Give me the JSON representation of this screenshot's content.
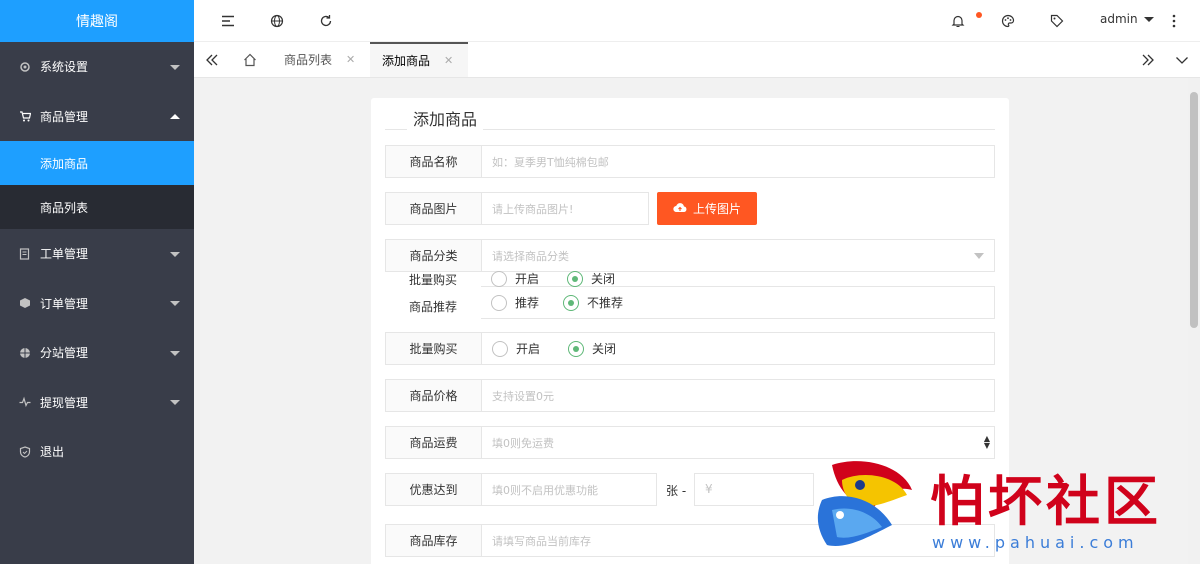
{
  "app": {
    "logo": "情趣阁"
  },
  "header": {
    "user": "admin"
  },
  "sidebar": {
    "items": [
      {
        "label": "系统设置",
        "icon": "gear-icon"
      },
      {
        "label": "商品管理",
        "icon": "cart-icon",
        "expanded": true
      },
      {
        "label": "工单管理",
        "icon": "ticket-icon"
      },
      {
        "label": "订单管理",
        "icon": "cube-icon"
      },
      {
        "label": "分站管理",
        "icon": "globe-icon"
      },
      {
        "label": "提现管理",
        "icon": "pulse-icon"
      },
      {
        "label": "退出",
        "icon": "shield-icon"
      }
    ],
    "sub": [
      {
        "label": "添加商品",
        "active": true
      },
      {
        "label": "商品列表"
      }
    ]
  },
  "tabs": [
    {
      "label": "商品列表"
    },
    {
      "label": "添加商品",
      "active": true
    }
  ],
  "form": {
    "title": "添加商品",
    "name": {
      "label": "商品名称",
      "placeholder": "如：夏季男T恤纯棉包邮"
    },
    "image": {
      "label": "商品图片",
      "placeholder": "请上传商品图片!",
      "button": "上传图片"
    },
    "category": {
      "label": "商品分类",
      "placeholder": "请选择商品分类"
    },
    "bulk_overlay": {
      "label": "批量购买",
      "on": "开启",
      "off": "关闭"
    },
    "recommend": {
      "label": "商品推荐",
      "on": "推荐",
      "off": "不推荐"
    },
    "bulk": {
      "label": "批量购买",
      "on": "开启",
      "off": "关闭"
    },
    "price": {
      "label": "商品价格",
      "placeholder": "支持设置0元"
    },
    "shipping": {
      "label": "商品运费",
      "placeholder": "填0则免运费"
    },
    "discount": {
      "label": "优惠达到",
      "placeholder": "填0则不启用优惠功能",
      "unit": "张 -",
      "currency": "¥"
    },
    "stock": {
      "label": "商品库存",
      "placeholder": "请填写商品当前库存"
    }
  },
  "watermark": {
    "text": "怕坏社区",
    "url": "www.pahuai.com"
  },
  "colors": {
    "accent": "#1E9FFF",
    "sidebar": "#393d49",
    "upload": "#ff5722",
    "radio_on": "#5fb878"
  }
}
